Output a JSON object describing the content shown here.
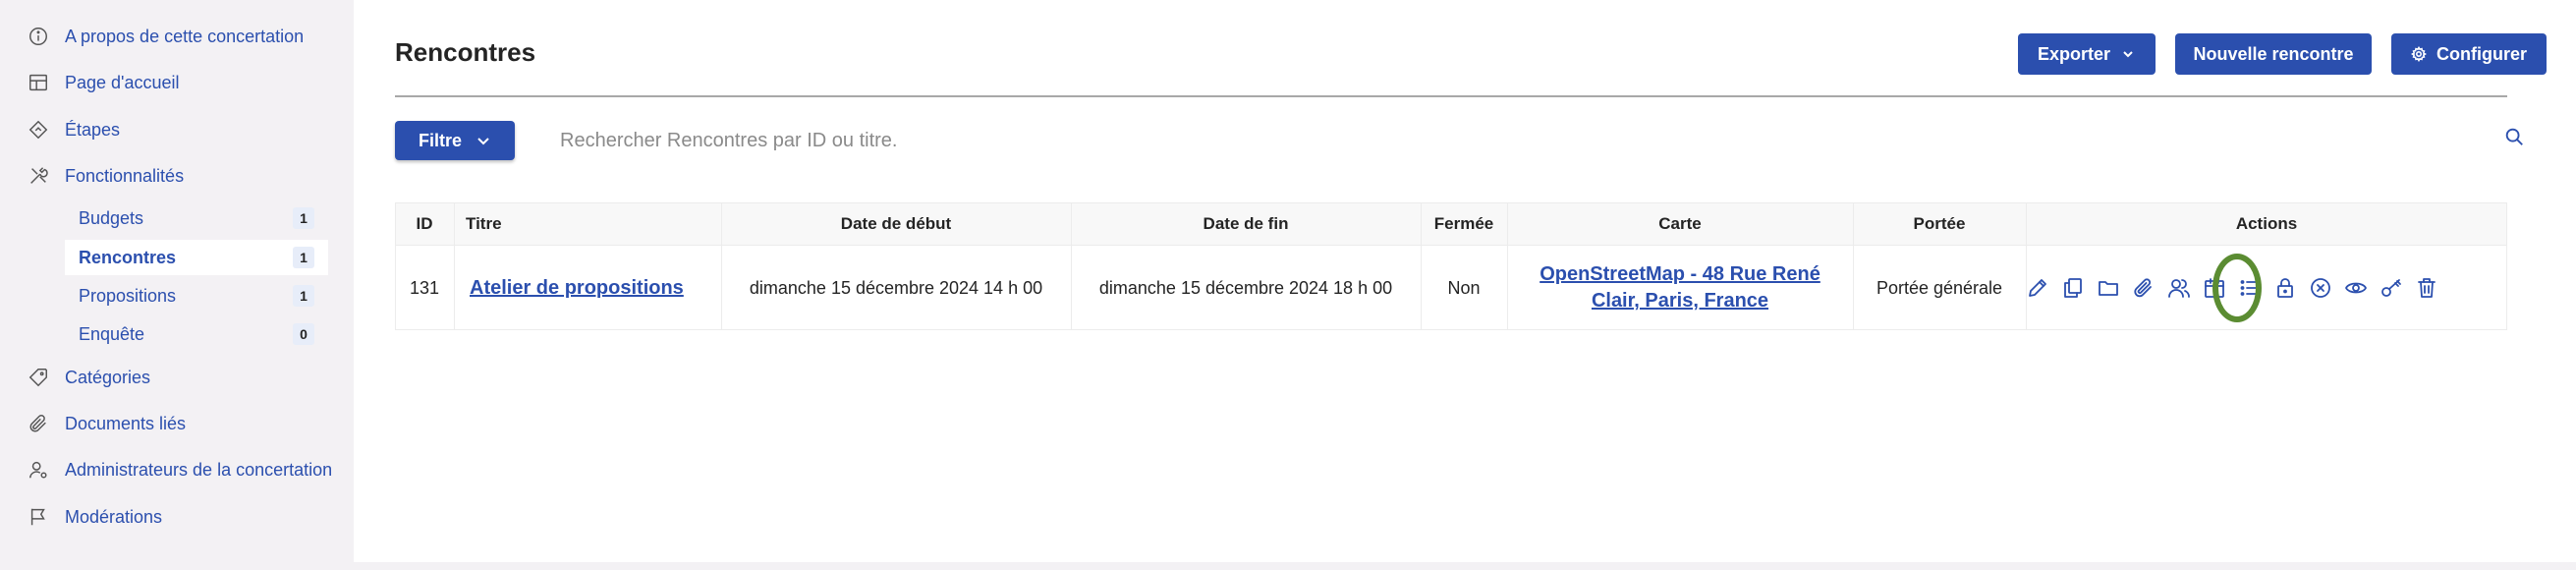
{
  "sidebar": {
    "items": [
      {
        "label": "A propos de cette concertation",
        "icon": "info-circle-icon"
      },
      {
        "label": "Page d'accueil",
        "icon": "layout-grid-icon"
      },
      {
        "label": "Étapes",
        "icon": "diamond-route-icon"
      },
      {
        "label": "Fonctionnalités",
        "icon": "tools-icon"
      },
      {
        "label": "Catégories",
        "icon": "tag-icon"
      },
      {
        "label": "Documents liés",
        "icon": "paperclip-icon"
      },
      {
        "label": "Administrateurs de la concertation",
        "icon": "user-gear-icon"
      },
      {
        "label": "Modérations",
        "icon": "flag-icon"
      }
    ],
    "subitems": [
      {
        "label": "Budgets",
        "count": "1"
      },
      {
        "label": "Rencontres",
        "count": "1",
        "active": true
      },
      {
        "label": "Propositions",
        "count": "1"
      },
      {
        "label": "Enquête",
        "count": "0"
      }
    ]
  },
  "header": {
    "title": "Rencontres",
    "export_label": "Exporter",
    "new_label": "Nouvelle rencontre",
    "configure_label": "Configurer"
  },
  "filter": {
    "filter_label": "Filtre",
    "search_placeholder": "Rechercher Rencontres par ID ou titre."
  },
  "table": {
    "columns": [
      "ID",
      "Titre",
      "Date de début",
      "Date de fin",
      "Fermée",
      "Carte",
      "Portée",
      "Actions"
    ],
    "rows": [
      {
        "id": "131",
        "title": "Atelier de propositions",
        "start": "dimanche 15 décembre 2024 14 h 00",
        "end": "dimanche 15 décembre 2024 18 h 00",
        "closed": "Non",
        "map_line1": "OpenStreetMap - 48 Rue René",
        "map_line2": "Clair, Paris, France",
        "scope": "Portée générale",
        "actions": [
          "pencil-icon",
          "copy-icon",
          "folder-icon",
          "paperclip-icon",
          "users-icon",
          "calendar-icon",
          "list-icon",
          "lock-icon",
          "x-circle-icon",
          "eye-icon",
          "key-icon",
          "trash-icon"
        ]
      }
    ]
  },
  "colors": {
    "accent": "#2b4fae",
    "highlight": "#5b8c32",
    "sidebar_bg": "#f3f1f4"
  }
}
